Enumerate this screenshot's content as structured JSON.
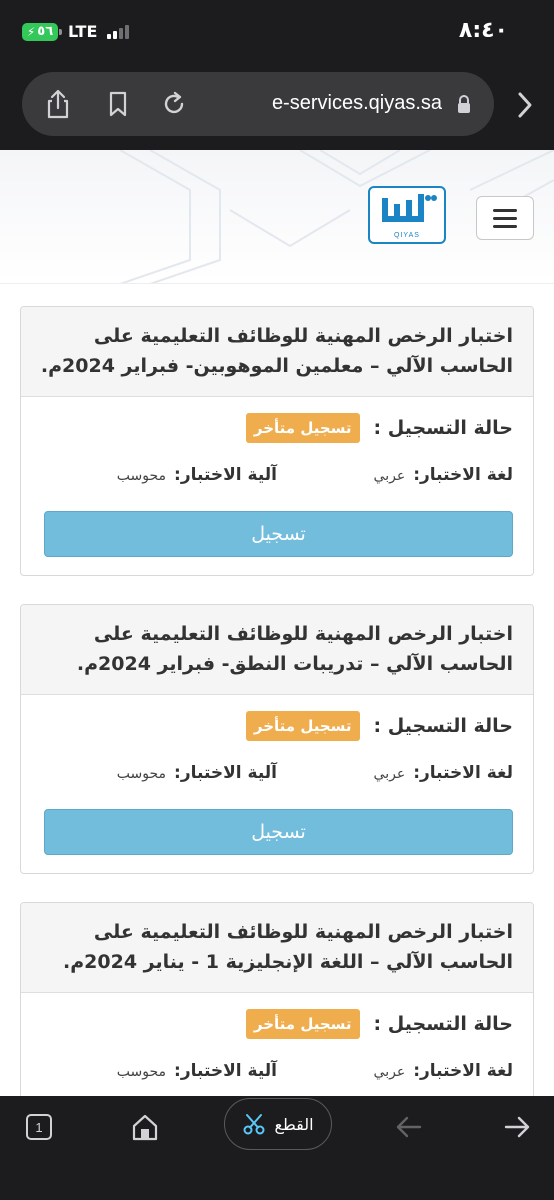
{
  "status_bar": {
    "time": "٨:٤٠",
    "battery": "٥٦",
    "network": "LTE"
  },
  "browser": {
    "url": "e-services.qiyas.sa"
  },
  "site": {
    "logo_text": "QIYAS",
    "brand_color": "#1b84c4"
  },
  "labels": {
    "status": "حالة التسجيل :",
    "lang": "لغة الاختبار:",
    "mechanism": "آلية الاختبار:",
    "register": "تسجيل"
  },
  "cards": [
    {
      "title_line1": "اختبار الرخص المهنية للوظائف التعليمية على",
      "title_line2": "الحاسب الآلي – معلمين الموهوبين- فبراير 2024م.",
      "status": "تسجيل متأخر",
      "lang": "عربي",
      "mechanism": "محوسب"
    },
    {
      "title_line1": "اختبار الرخص المهنية للوظائف التعليمية على",
      "title_line2": "الحاسب الآلي – تدريبات النطق- فبراير 2024م.",
      "status": "تسجيل متأخر",
      "lang": "عربي",
      "mechanism": "محوسب"
    },
    {
      "title_line1": "اختبار الرخص المهنية للوظائف التعليمية على",
      "title_line2": "الحاسب الآلي – اللغة الإنجليزية 1 - يناير 2024م.",
      "status": "تسجيل متأخر",
      "lang": "عربي",
      "mechanism": "محوسب"
    }
  ],
  "toolbar": {
    "tab_count": "1",
    "cut_label": "القطع"
  },
  "colors": {
    "badge": "#f0ad4e",
    "register_button": "#72bcdc"
  }
}
